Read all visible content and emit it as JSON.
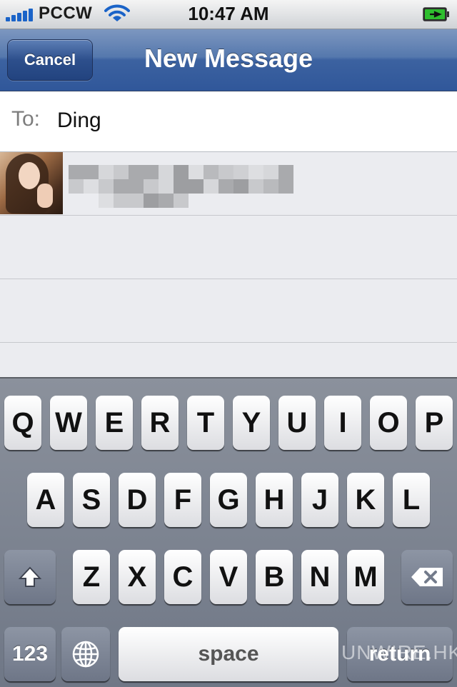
{
  "status_bar": {
    "carrier": "PCCW",
    "time": "10:47 AM",
    "signal_icon": "signal-bars-icon",
    "wifi_icon": "wifi-icon",
    "battery_icon": "battery-charging-icon"
  },
  "nav": {
    "cancel_label": "Cancel",
    "title": "New Message"
  },
  "to_field": {
    "label": "To:",
    "value": "Ding"
  },
  "suggestions": [
    {
      "avatar": "contact-photo",
      "name": ""
    }
  ],
  "keyboard": {
    "row1": [
      "Q",
      "W",
      "E",
      "R",
      "T",
      "Y",
      "U",
      "I",
      "O",
      "P"
    ],
    "row2": [
      "A",
      "S",
      "D",
      "F",
      "G",
      "H",
      "J",
      "K",
      "L"
    ],
    "row3": [
      "Z",
      "X",
      "C",
      "V",
      "B",
      "N",
      "M"
    ],
    "shift_icon": "shift-arrow-icon",
    "backspace_icon": "backspace-icon",
    "numbers_label": "123",
    "globe_icon": "globe-icon",
    "space_label": "space",
    "return_label": "return"
  },
  "watermark": "UNWIRE.HK",
  "colors": {
    "nav_blue": "#3c62a0",
    "signal_blue": "#1a63c8",
    "battery_green": "#2fbf2f"
  }
}
